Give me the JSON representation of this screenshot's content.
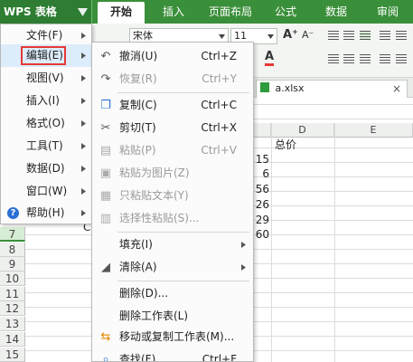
{
  "app_button": {
    "label": "WPS 表格"
  },
  "ribbon_tabs": [
    "开始",
    "插入",
    "页面布局",
    "公式",
    "数据",
    "审阅"
  ],
  "toolbar": {
    "font_name": "宋体",
    "font_size": "11",
    "font_grow": "A⁺",
    "font_shrink": "A⁻",
    "font_color": "A"
  },
  "file_tab": {
    "name": "a.xlsx",
    "close": "×"
  },
  "main_menu": {
    "items": [
      {
        "label": "文件(F)"
      },
      {
        "label": "编辑(E)"
      },
      {
        "label": "视图(V)"
      },
      {
        "label": "插入(I)"
      },
      {
        "label": "格式(O)"
      },
      {
        "label": "工具(T)"
      },
      {
        "label": "数据(D)"
      },
      {
        "label": "窗口(W)"
      },
      {
        "label": "帮助(H)"
      }
    ],
    "help_icon": "?"
  },
  "edit_menu": {
    "items": [
      {
        "label": "撤消(U)",
        "shortcut": "Ctrl+Z",
        "icon": "undo-icon",
        "glyph": "↶",
        "enabled": true
      },
      {
        "label": "恢复(R)",
        "shortcut": "Ctrl+Y",
        "icon": "redo-icon",
        "glyph": "↷",
        "enabled": false
      },
      {
        "label": "复制(C)",
        "shortcut": "Ctrl+C",
        "icon": "copy-icon",
        "glyph": "❐",
        "enabled": true
      },
      {
        "label": "剪切(T)",
        "shortcut": "Ctrl+X",
        "icon": "scissors-icon",
        "glyph": "✂",
        "enabled": true
      },
      {
        "label": "粘贴(P)",
        "shortcut": "Ctrl+V",
        "icon": "paste-icon",
        "glyph": "▤",
        "enabled": false
      },
      {
        "label": "粘贴为图片(Z)",
        "shortcut": "",
        "icon": "paste-picture-icon",
        "glyph": "▣",
        "enabled": false
      },
      {
        "label": "只粘贴文本(Y)",
        "shortcut": "",
        "icon": "paste-text-icon",
        "glyph": "▦",
        "enabled": false
      },
      {
        "label": "选择性粘贴(S)...",
        "shortcut": "",
        "icon": "paste-special-icon",
        "glyph": "▥",
        "enabled": false
      },
      {
        "label": "填充(I)",
        "shortcut": "",
        "icon": "",
        "glyph": "",
        "enabled": true
      },
      {
        "label": "清除(A)",
        "shortcut": "",
        "icon": "eraser-icon",
        "glyph": "◢",
        "enabled": true
      },
      {
        "label": "删除(D)...",
        "shortcut": "",
        "icon": "",
        "glyph": "",
        "enabled": true
      },
      {
        "label": "删除工作表(L)",
        "shortcut": "",
        "icon": "",
        "glyph": "",
        "enabled": true
      },
      {
        "label": "移动或复制工作表(M)...",
        "shortcut": "",
        "icon": "move-sheet-icon",
        "glyph": "⇆",
        "enabled": true
      },
      {
        "label": "查找(F)...",
        "shortcut": "Ctrl+F",
        "icon": "find-icon",
        "glyph": "⌕",
        "enabled": true
      }
    ]
  },
  "sheet": {
    "columns": [
      "D",
      "E"
    ],
    "rows": [
      "7",
      "8",
      "9",
      "10",
      "11",
      "12",
      "13",
      "14",
      "15"
    ],
    "header_cell": "总价",
    "values": [
      "15",
      "6",
      "56",
      "26",
      "29",
      "60"
    ],
    "row7_fragment": "C"
  },
  "colors": {
    "ribbon_green": "#3a8f3a",
    "highlight": "#dcecfb",
    "red_box": "#e53935"
  }
}
